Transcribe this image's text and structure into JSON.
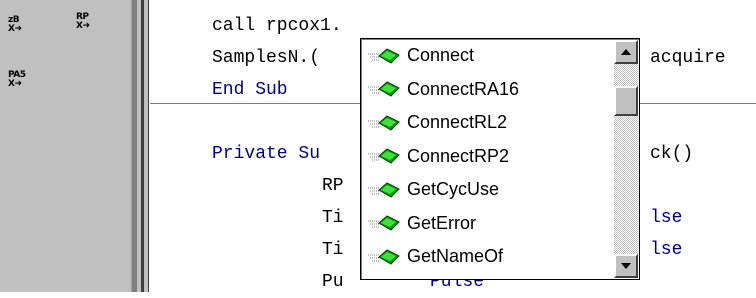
{
  "toolbox": {
    "tools": [
      {
        "label": "zB",
        "sub": "X➜"
      },
      {
        "label": "RP",
        "sub": "X➜"
      },
      {
        "label": "PA5",
        "sub": "X➜"
      }
    ]
  },
  "code": {
    "lines": [
      {
        "text": "call rpcox1.",
        "keyword": false
      },
      {
        "text": "SamplesN.(",
        "keyword": false
      },
      {
        "text": "End Sub",
        "keyword": true
      },
      {
        "text": "Private Su",
        "keyword": true
      },
      {
        "text": "RP",
        "keyword": false
      },
      {
        "text": "Ti",
        "keyword": false
      },
      {
        "text": "Ti",
        "keyword": false
      },
      {
        "text": "Pu",
        "keyword": false
      }
    ],
    "fragments": [
      {
        "text": "acquire",
        "keyword": false
      },
      {
        "text": "ck()",
        "keyword": false
      },
      {
        "text": "lse",
        "keyword": true
      },
      {
        "text": "lse",
        "keyword": true
      },
      {
        "text": "Pulse",
        "keyword": true
      }
    ]
  },
  "autocomplete": {
    "items": [
      "Connect",
      "ConnectRA16",
      "ConnectRL2",
      "ConnectRP2",
      "GetCycUse",
      "GetError",
      "GetNameOf"
    ],
    "item_icon": "method-icon"
  }
}
